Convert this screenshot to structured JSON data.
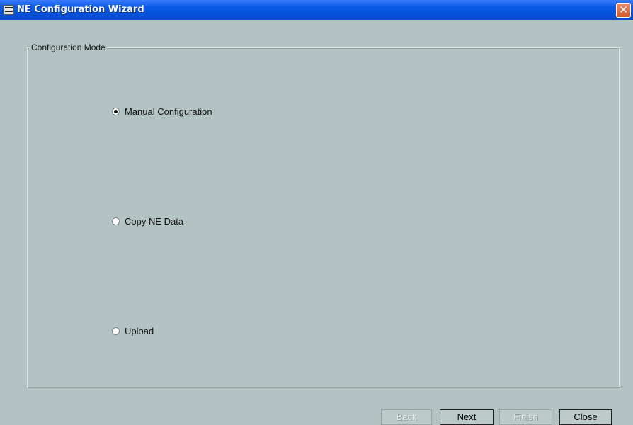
{
  "window": {
    "title": "NE Configuration Wizard",
    "close_glyph": "✕",
    "icon": "app-logo-icon"
  },
  "group": {
    "legend": "Configuration Mode"
  },
  "options": [
    {
      "label": "Manual Configuration",
      "selected": true
    },
    {
      "label": "Copy NE Data",
      "selected": false
    },
    {
      "label": "Upload",
      "selected": false
    }
  ],
  "buttons": {
    "back": {
      "label": "Back",
      "enabled": false
    },
    "next": {
      "label": "Next",
      "enabled": true
    },
    "finish": {
      "label": "Finish",
      "enabled": false
    },
    "close": {
      "label": "Close",
      "enabled": true
    }
  }
}
